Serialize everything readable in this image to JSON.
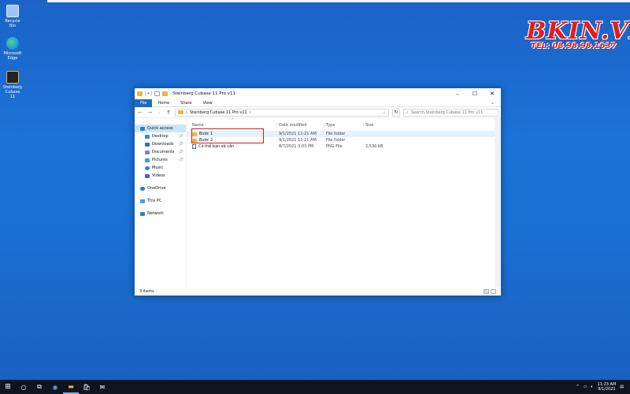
{
  "desktop": {
    "icons": [
      {
        "label": "Recycle Bin",
        "icon": "recycle-bin-icon",
        "color": "#9ec6f0"
      },
      {
        "label": "Microsoft Edge",
        "icon": "edge-icon",
        "color": "#1aa0e0"
      },
      {
        "label": "Steinberg Cubase 11",
        "icon": "cubase-icon",
        "color": "#222222"
      }
    ],
    "watermark": {
      "brand": "BKIN.VN",
      "phone": "TEL: 08.98.98.1637",
      "color": "#e11e1e"
    }
  },
  "window": {
    "title": "Steinberg Cubase 11 Pro v11",
    "title_prefix": "| ▾ |",
    "ribbon_tabs": [
      "File",
      "Home",
      "Share",
      "View"
    ],
    "address": {
      "path": "Steinberg Cubase 11 Pro v11",
      "search_placeholder": "Search Steinberg Cubase 11 Pro v11"
    },
    "sidebar": {
      "items": [
        {
          "label": "Quick access",
          "icon": "star-icon",
          "level": 0,
          "selected": true,
          "pinned": false
        },
        {
          "label": "Desktop",
          "icon": "desktop-icon",
          "level": 1,
          "pinned": true
        },
        {
          "label": "Downloads",
          "icon": "download-icon",
          "level": 1,
          "pinned": true
        },
        {
          "label": "Documents",
          "icon": "documents-icon",
          "level": 1,
          "pinned": true
        },
        {
          "label": "Pictures",
          "icon": "pictures-icon",
          "level": 1,
          "pinned": true
        },
        {
          "label": "Music",
          "icon": "music-icon",
          "level": 1,
          "pinned": false
        },
        {
          "label": "Videos",
          "icon": "videos-icon",
          "level": 1,
          "pinned": false
        },
        {
          "label": "OneDrive",
          "icon": "onedrive-icon",
          "level": 0,
          "pinned": false
        },
        {
          "label": "This PC",
          "icon": "pc-icon",
          "level": 0,
          "pinned": false
        },
        {
          "label": "Network",
          "icon": "network-icon",
          "level": 0,
          "pinned": false
        }
      ]
    },
    "columns": [
      "Name",
      "Date modified",
      "Type",
      "Size"
    ],
    "files": [
      {
        "name": "Bước 1",
        "date": "9/1/2021 11:21 AM",
        "type": "File folder",
        "size": "",
        "icon": "folder-icon"
      },
      {
        "name": "Bước 2",
        "date": "9/1/2021 11:21 AM",
        "type": "File folder",
        "size": "",
        "icon": "folder-icon"
      },
      {
        "name": "Có thể bạn sẽ cần",
        "date": "8/7/2021 3:03 PM",
        "type": "PNG File",
        "size": "2,530 KB",
        "icon": "image-file-icon"
      }
    ],
    "status": "3 items"
  },
  "taskbar": {
    "time": "11:23 AM",
    "date": "9/1/2021"
  }
}
